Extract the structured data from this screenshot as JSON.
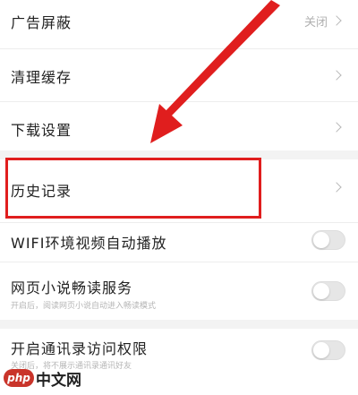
{
  "settings": {
    "ad_block": {
      "label": "广告屏蔽",
      "value": "关闭"
    },
    "clear_cache": {
      "label": "清理缓存"
    },
    "download_settings": {
      "label": "下载设置"
    },
    "history": {
      "label": "历史记录"
    },
    "wifi_autoplay": {
      "label": "WIFI环境视频自动播放",
      "enabled": false
    },
    "novel_reading": {
      "label": "网页小说畅读服务",
      "sub": "开启后，阅读网页小说自动进入畅读模式",
      "enabled": false
    },
    "contacts_permission": {
      "label": "开启通讯录访问权限",
      "sub": "关闭后，将不展示通讯录通讯好友",
      "enabled": false
    }
  },
  "annotation": {
    "color": "#e01e1e",
    "target": "历史记录"
  },
  "watermark": {
    "logo": "php",
    "text": "中文网"
  },
  "icons": {
    "chevron": "chevron-right-icon"
  }
}
